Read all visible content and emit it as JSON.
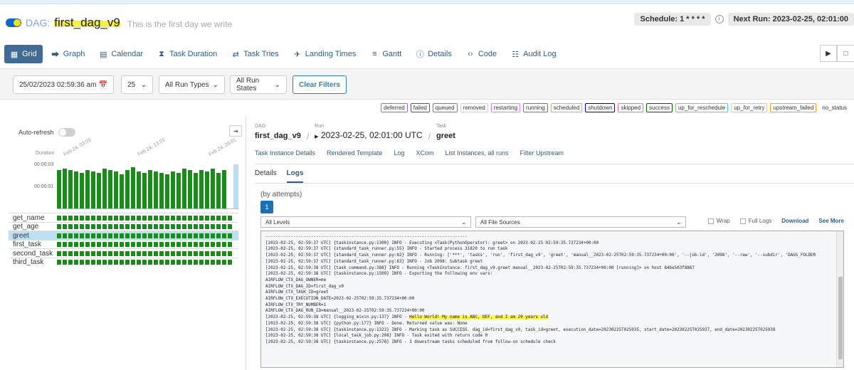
{
  "header": {
    "dag_prefix": "DAG:",
    "dag_id": "first_dag_v9",
    "description": "This is the first day we write",
    "schedule": "Schedule: 1 * * * *",
    "next_run": "Next Run: 2023-02-25, 02:01:00"
  },
  "nav": [
    {
      "label": "Grid",
      "icon": "grid-icon"
    },
    {
      "label": "Graph",
      "icon": "graph-icon"
    },
    {
      "label": "Calendar",
      "icon": "calendar-icon"
    },
    {
      "label": "Task Duration",
      "icon": "hourglass-icon"
    },
    {
      "label": "Task Tries",
      "icon": "retry-icon"
    },
    {
      "label": "Landing Times",
      "icon": "landing-icon"
    },
    {
      "label": "Gantt",
      "icon": "gantt-icon"
    },
    {
      "label": "Details",
      "icon": "info-icon"
    },
    {
      "label": "Code",
      "icon": "code-icon"
    },
    {
      "label": "Audit Log",
      "icon": "audit-icon"
    }
  ],
  "filters": {
    "datetime": "25/02/2023 02:59:36 am",
    "num_runs": "25",
    "run_types": "All Run Types",
    "run_states": "All Run States",
    "clear_label": "Clear Filters"
  },
  "legend": [
    "deferred",
    "failed",
    "queued",
    "removed",
    "restarting",
    "running",
    "scheduled",
    "shutdown",
    "skipped",
    "success",
    "up_for_reschedule",
    "up_for_retry",
    "upstream_failed",
    "no_status"
  ],
  "legend_colors": {
    "deferred": "#9370db",
    "failed": "#e02020",
    "queued": "#808080",
    "removed": "#d3d3d3",
    "restarting": "#ee82ee",
    "running": "#00cc00",
    "scheduled": "#d2b48c",
    "shutdown": "#0000cc",
    "skipped": "#ff69b4",
    "success": "#006400",
    "up_for_reschedule": "#40e0d0",
    "up_for_retry": "#ffd700",
    "upstream_failed": "#ffa500",
    "no_status": "#ffffff"
  },
  "grid": {
    "auto_refresh": "Auto-refresh",
    "duration_label": "Duration",
    "ticks": [
      "00:00:03",
      "00:00:01",
      "00:00:00"
    ],
    "dates": [
      "Feb 24, 03:01",
      "Feb 24, 13:01",
      "Feb 24, 23:01"
    ],
    "tasks": [
      "get_name",
      "get_age",
      "greet",
      "first_task",
      "second_task",
      "third_task"
    ],
    "selected_task": "greet",
    "durations": [
      2.8,
      2.9,
      2.8,
      2.7,
      2.6,
      2.8,
      2.7,
      2.6,
      2.9,
      2.8,
      2.7,
      2.5,
      2.8,
      3.0,
      2.7,
      2.6,
      2.8,
      2.7,
      2.6,
      2.5,
      2.7,
      2.6,
      2.9,
      2.8,
      2.6,
      2.8,
      2.7,
      2.9,
      2.6,
      2.8
    ],
    "max_duration": 3.2,
    "run_count": 31
  },
  "detail": {
    "dag_key": "DAG",
    "dag_val": "first_dag_v9",
    "run_key": "Run",
    "run_val": "2023-02-25, 02:01:00 UTC",
    "task_key": "Task",
    "task_val": "greet",
    "subtabs": [
      "Task Instance Details",
      "Rendered Template",
      "Log",
      "XCom",
      "List Instances, all runs",
      "Filter Upstream"
    ],
    "tabs": [
      "Details",
      "Logs"
    ],
    "attempts_label": "(by attempts)",
    "attempt": "1",
    "levels": "All Levels",
    "sources": "All File Sources",
    "wrap": "Wrap",
    "full_logs": "Full Logs",
    "download": "Download",
    "see_more": "See More"
  },
  "log_lines": [
    "--------------------------------------------------------------------------------",
    "[2023-02-25, 02:59:37 UTC] {taskinstance.py:1300} INFO - Executing <Task(PythonOperator): greet> on 2023-02-25 02:59:35.737234+00:00",
    "[2023-02-25, 02:59:37 UTC] {standard_task_runner.py:55} INFO - Started process 31820 to run task",
    "[2023-02-25, 02:59:37 UTC] {standard_task_runner.py:82} INFO - Running: ['***', 'tasks', 'run', 'first_dag_v9', 'greet', 'manual__2023-02-25T02:59:35.737234+00:00', '--job-id', '2098', '--raw', '--subdir', 'DAGS_FOLDER",
    "[2023-02-25, 02:59:37 UTC] {standard_task_runner.py:83} INFO - Job 2098: Subtask greet",
    "[2023-02-25, 02:59:38 UTC] {task_command.py:388} INFO - Running <TaskInstance: first_dag_v9.greet manual__2023-02-25T02:59:35.737234+00:00 [running]> on host 84be503f8867",
    "[2023-02-25, 02:59:38 UTC] {taskinstance.py:1509} INFO - Exporting the following env vars:",
    "AIRFLOW_CTX_DAG_OWNER=me",
    "AIRFLOW_CTX_DAG_ID=first_dag_v9",
    "AIRFLOW_CTX_TASK_ID=greet",
    "AIRFLOW_CTX_EXECUTION_DATE=2023-02-25T02:59:35.737234+00:00",
    "AIRFLOW_CTX_TRY_NUMBER=1",
    "AIRFLOW_CTX_DAG_RUN_ID=manual__2023-02-25T02:59:35.737234+00:00",
    "[2023-02-25, 02:59:38 UTC] {logging_mixin.py:137} INFO - ",
    "[2023-02-25, 02:59:38 UTC] {python.py:177} INFO - Done. Returned value was: None",
    "[2023-02-25, 02:59:38 UTC] {taskinstance.py:1323} INFO - Marking task as SUCCESS. dag_id=first_dag_v9, task_id=greet, execution_date=20230225T025935, start_date=20230225T025937, end_date=20230225T025938",
    "[2023-02-25, 02:59:38 UTC] {local_task_job.py:208} INFO - Task exited with return code 0",
    "[2023-02-25, 02:59:38 UTC] {taskinstance.py:2578} INFO - 3 downstream tasks scheduled from follow-on schedule check"
  ],
  "log_highlight": "Hello World! My name is ABC, DEF, and I am 20 years old",
  "log_highlight_line": 13
}
